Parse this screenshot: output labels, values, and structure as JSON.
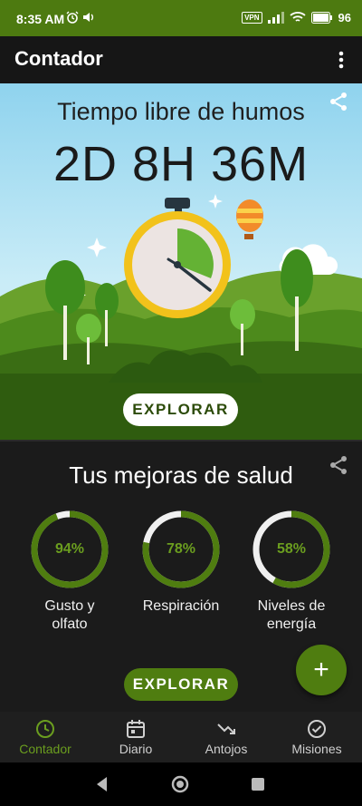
{
  "status": {
    "time": "8:35 AM",
    "vpn": "VPN",
    "battery": "96"
  },
  "app_bar": {
    "title": "Contador"
  },
  "hero": {
    "title": "Tiempo libre de humos",
    "timer": "2D 8H 36M",
    "explore_label": "EXPLORAR",
    "clock_progress": 0.35
  },
  "health": {
    "title": "Tus mejoras de salud",
    "items": [
      {
        "pct_label": "94%",
        "value": 0.94,
        "label_line1": "Gusto y",
        "label_line2": "olfato"
      },
      {
        "pct_label": "78%",
        "value": 0.78,
        "label_line1": "Respiración",
        "label_line2": ""
      },
      {
        "pct_label": "58%",
        "value": 0.58,
        "label_line1": "Niveles de",
        "label_line2": "energía"
      }
    ],
    "explore_label": "EXPLORAR",
    "fab_symbol": "+"
  },
  "bottom_nav": {
    "items": [
      {
        "label": "Contador",
        "icon": "clock-icon",
        "active": true
      },
      {
        "label": "Diario",
        "icon": "calendar-icon",
        "active": false
      },
      {
        "label": "Antojos",
        "icon": "trending-down-icon",
        "active": false
      },
      {
        "label": "Misiones",
        "icon": "check-circle-icon",
        "active": false
      }
    ]
  },
  "colors": {
    "brand_green": "#4f7d10",
    "accent_green": "#6b9e1f",
    "ring_track": "#f0f0f0"
  }
}
